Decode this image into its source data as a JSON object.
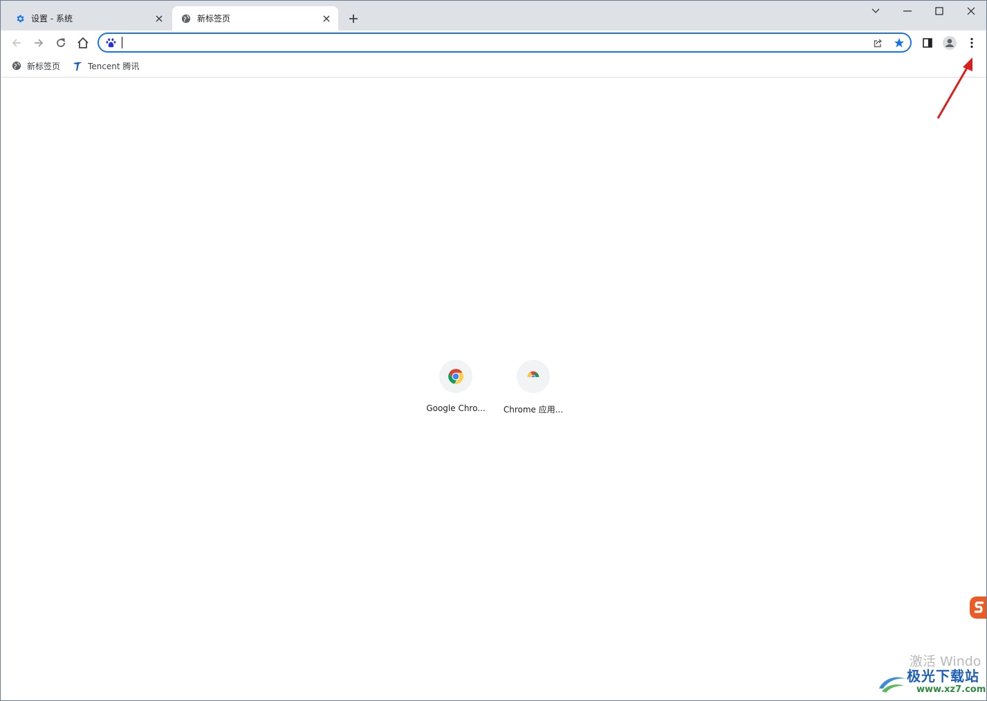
{
  "tabs": [
    {
      "title": "设置 - 系统",
      "icon": "settings-gear-icon",
      "active": false
    },
    {
      "title": "新标签页",
      "icon": "globe-icon",
      "active": true
    }
  ],
  "omnibox": {
    "value": "",
    "search_engine_icon": "baidu-paw-icon"
  },
  "bookmarks": [
    {
      "label": "新标签页",
      "icon": "globe-icon"
    },
    {
      "label": "Tencent 腾讯",
      "icon": "tencent-logo-icon"
    }
  ],
  "shortcuts": [
    {
      "label": "Google Chro...",
      "icon": "chrome-logo-icon"
    },
    {
      "label": "Chrome 应用...",
      "icon": "chrome-web-store-icon"
    }
  ],
  "watermark": {
    "activation_text": "激活 Windo",
    "site_name": "极光下载站",
    "site_url": "www.xz7.com"
  },
  "colors": {
    "accent": "#1a73e8",
    "titlebar_bg": "#dee1e6",
    "annotation_arrow": "#d9201f"
  }
}
